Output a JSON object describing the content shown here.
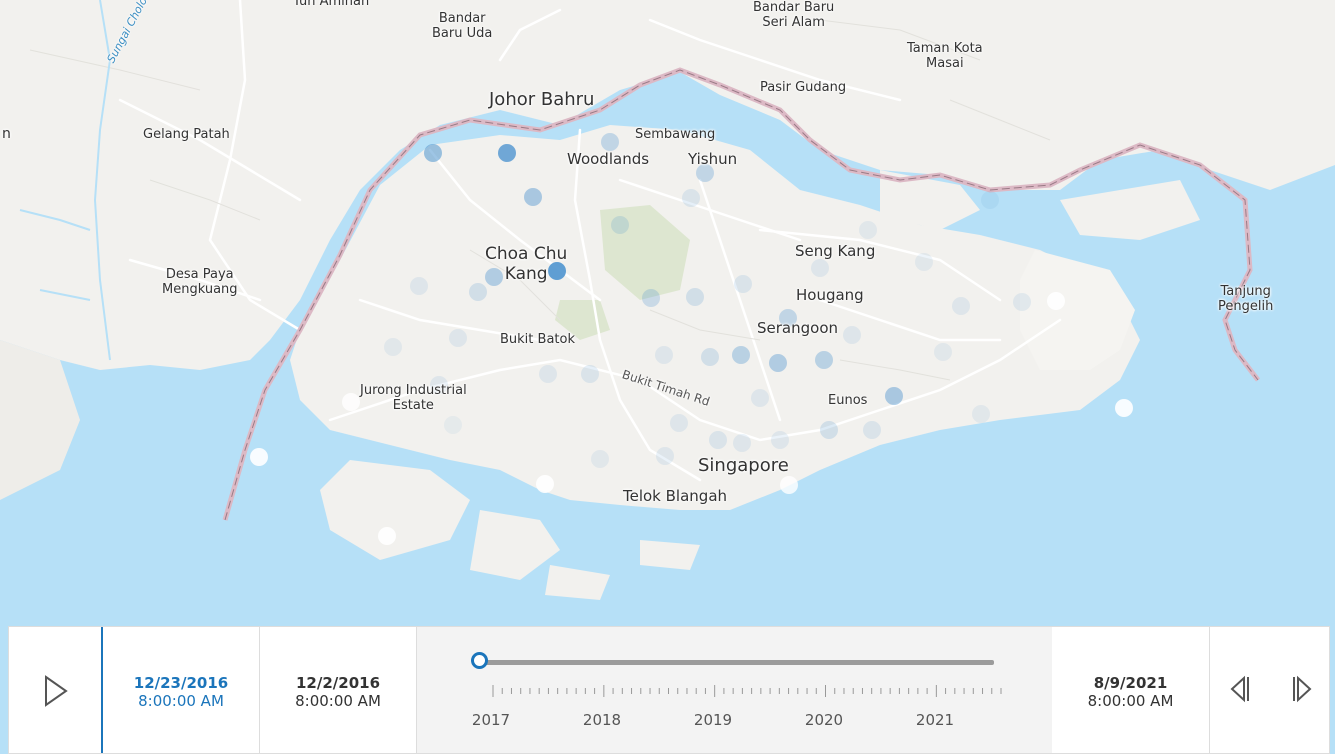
{
  "map": {
    "places": [
      {
        "id": "tun-aminah",
        "name": "Tun Aminah"
      },
      {
        "id": "bandar-baru-uda",
        "name": "Bandar\nBaru Uda"
      },
      {
        "id": "bandar-baru-seri-alam",
        "name": "Bandar Baru\nSeri Alam"
      },
      {
        "id": "taman-kota-masai",
        "name": "Taman Kota\nMasai"
      },
      {
        "id": "johor-bahru",
        "name": "Johor Bahru"
      },
      {
        "id": "pasir-gudang",
        "name": "Pasir Gudang"
      },
      {
        "id": "gelang-patah",
        "name": "Gelang Patah"
      },
      {
        "id": "sembawang",
        "name": "Sembawang"
      },
      {
        "id": "woodlands",
        "name": "Woodlands"
      },
      {
        "id": "yishun",
        "name": "Yishun"
      },
      {
        "id": "seng-kang",
        "name": "Seng Kang"
      },
      {
        "id": "choa-chu-kang",
        "name": "Choa Chu\nKang"
      },
      {
        "id": "desa-paya-mengkuang",
        "name": "Desa Paya\nMengkuang"
      },
      {
        "id": "hougang",
        "name": "Hougang"
      },
      {
        "id": "tanjung-pengelih",
        "name": "Tanjung\nPengelih"
      },
      {
        "id": "serangoon",
        "name": "Serangoon"
      },
      {
        "id": "bukit-batok",
        "name": "Bukit Batok"
      },
      {
        "id": "jurong-industrial-estate",
        "name": "Jurong Industrial\nEstate"
      },
      {
        "id": "bukit-timah-rd",
        "name": "Bukit Timah Rd"
      },
      {
        "id": "eunos",
        "name": "Eunos"
      },
      {
        "id": "singapore",
        "name": "Singapore"
      },
      {
        "id": "telok-blangah",
        "name": "Telok Blangah"
      },
      {
        "id": "sungai-cholong",
        "name": "Sungai Cholong"
      },
      {
        "id": "edge-n",
        "name": "n"
      }
    ],
    "colors": {
      "water": "#b6e0f7",
      "land": "#f2f1ee",
      "road": "#ffffff",
      "border": "#c99aa9",
      "dot": "#4f95cf",
      "park": "#dde6d0"
    }
  },
  "timeslider": {
    "current_date": "12/23/2016",
    "current_time": "8:00:00 AM",
    "start_date": "12/2/2016",
    "start_time": "8:00:00 AM",
    "end_date": "8/9/2021",
    "end_time": "8:00:00 AM",
    "years": [
      "2017",
      "2018",
      "2019",
      "2020",
      "2021"
    ],
    "progress": 0.0,
    "play_icon": "play-icon",
    "prev_icon": "step-back-icon",
    "next_icon": "step-forward-icon"
  }
}
